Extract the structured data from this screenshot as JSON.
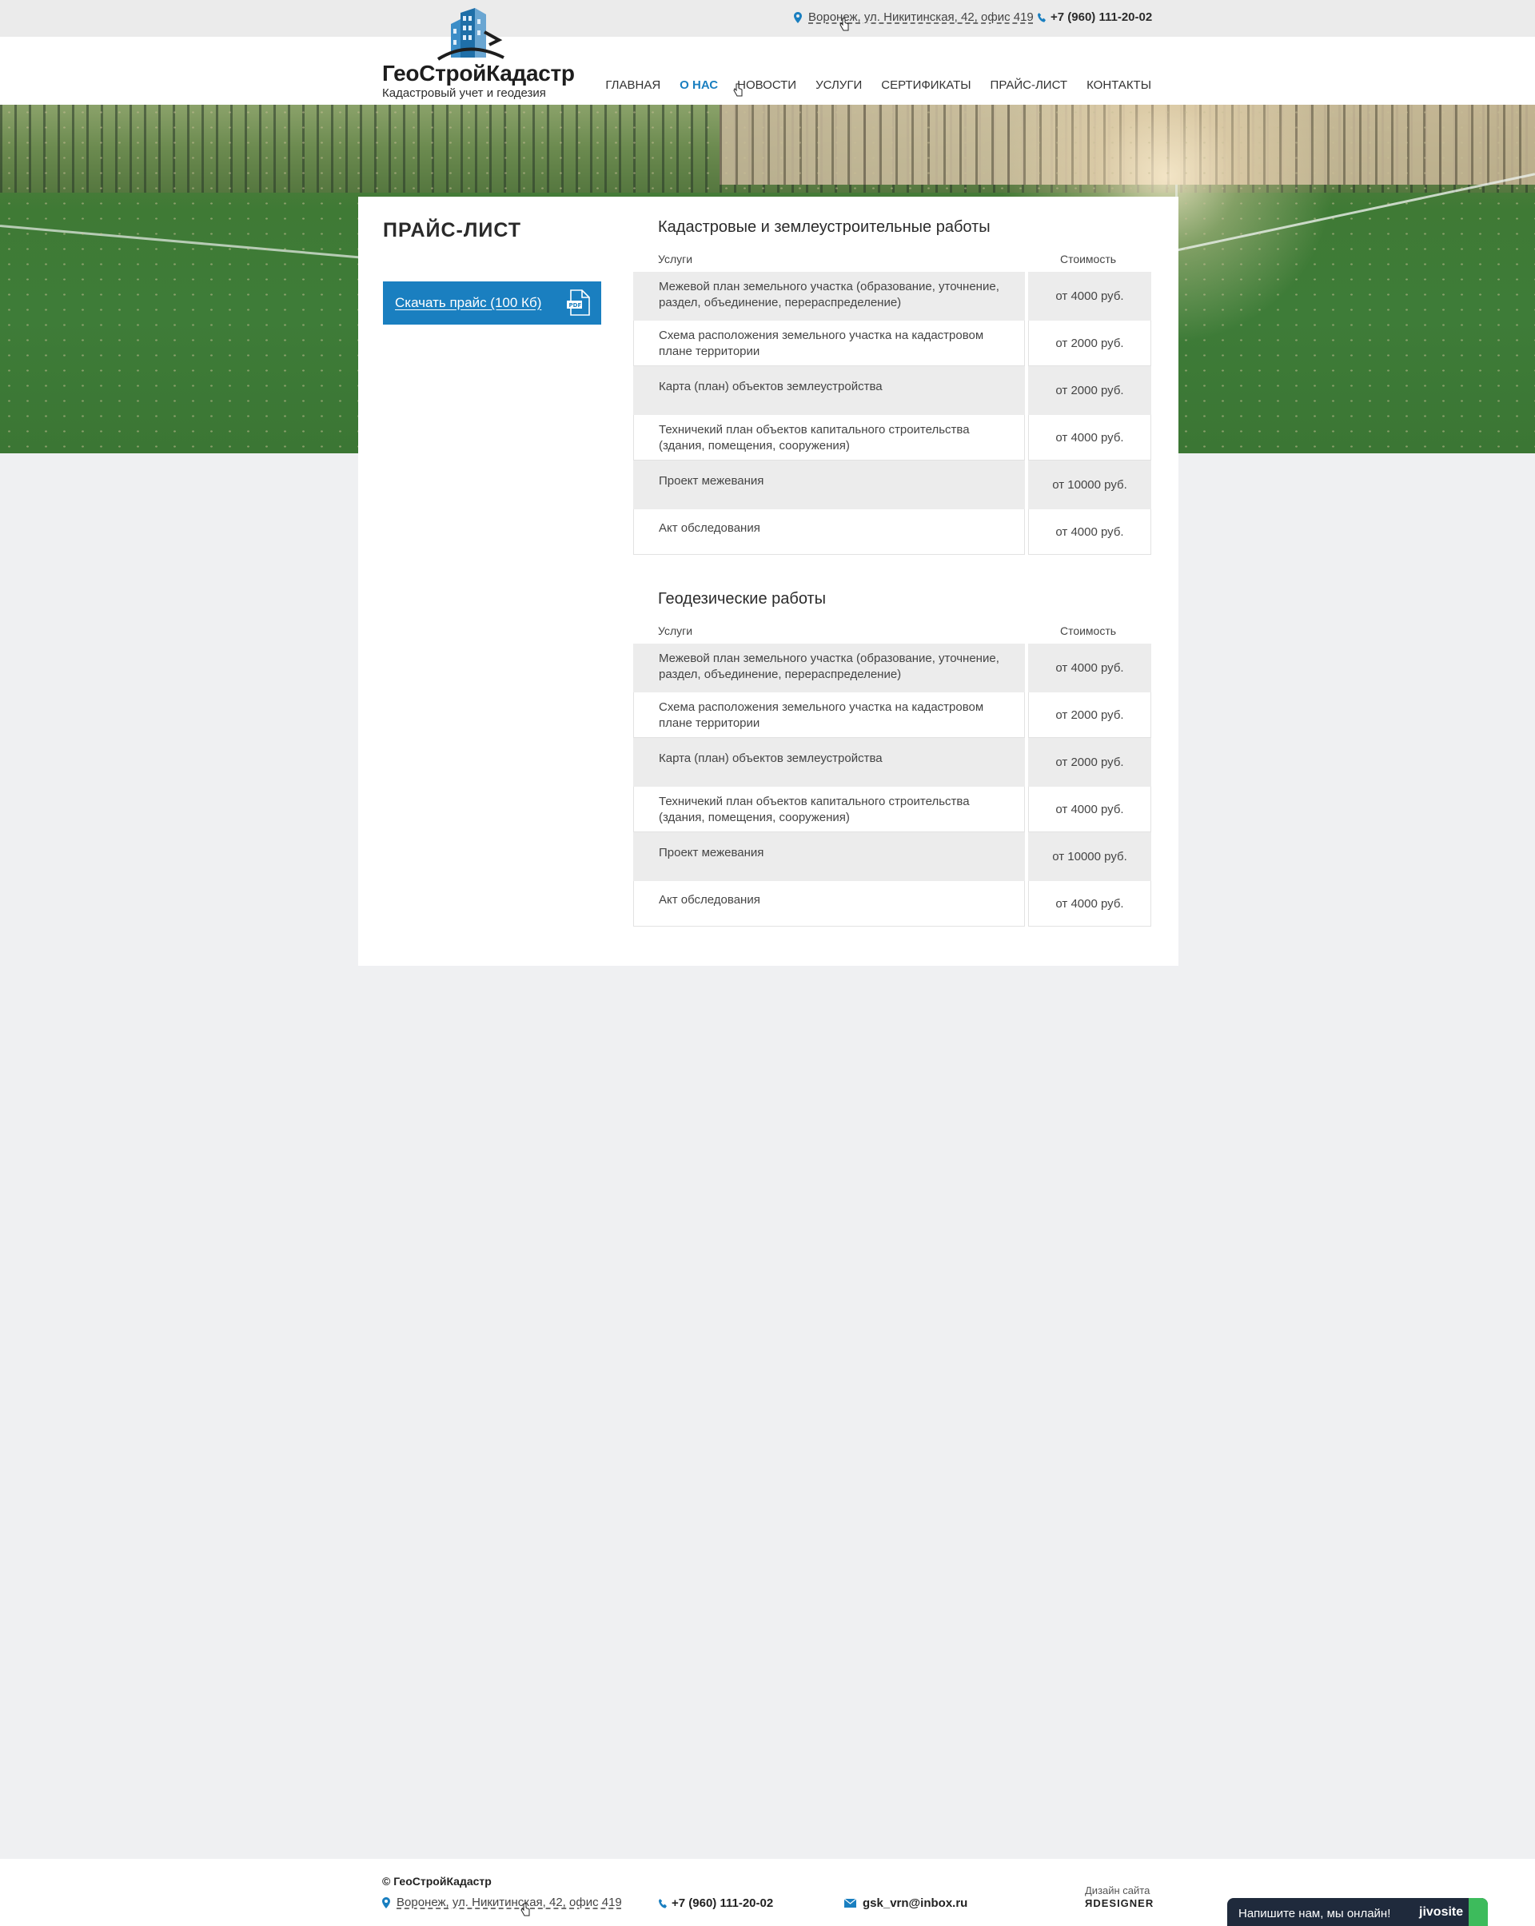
{
  "topbar": {
    "address": "Воронеж, ул. Никитинская, 42, офис 419",
    "phone": "+7 (960) 111-20-02"
  },
  "logo": {
    "title": "ГеоСтройКадастр",
    "subtitle": "Кадастровый учет и геодезия"
  },
  "nav": [
    {
      "label": "Главная",
      "active": false
    },
    {
      "label": "О нас",
      "active": true
    },
    {
      "label": "Новости",
      "active": false
    },
    {
      "label": "Услуги",
      "active": false
    },
    {
      "label": "Сертификаты",
      "active": false
    },
    {
      "label": "Прайс-лист",
      "active": false
    },
    {
      "label": "Контакты",
      "active": false
    }
  ],
  "page": {
    "title": "Прайс-лист",
    "download_label": "Скачать прайс (100 Кб)",
    "pdf_icon_text": "PDF"
  },
  "sections": [
    {
      "title": "Кадастровые и землеустроительные работы",
      "col_service": "Услуги",
      "col_price": "Стоимость",
      "rows": [
        {
          "service": "Межевой план земельного участка (образование, уточнение, раздел, объединение, перераспределение)",
          "price": "от 4000 руб."
        },
        {
          "service": "Схема расположения земельного участка на кадастровом плане территории",
          "price": "от 2000 руб."
        },
        {
          "service": "Карта (план) объектов землеустройства",
          "price": "от 2000 руб."
        },
        {
          "service": "Техничекий план объектов капитального строительства (здания, помещения, сооружения)",
          "price": "от 4000 руб."
        },
        {
          "service": "Проект межевания",
          "price": "от 10000 руб."
        },
        {
          "service": "Акт обследования",
          "price": "от 4000 руб."
        }
      ]
    },
    {
      "title": "Геодезические работы",
      "col_service": "Услуги",
      "col_price": "Стоимость",
      "rows": [
        {
          "service": "Межевой план земельного участка (образование, уточнение, раздел, объединение, перераспределение)",
          "price": "от 4000 руб."
        },
        {
          "service": "Схема расположения земельного участка на кадастровом плане территории",
          "price": "от 2000 руб."
        },
        {
          "service": "Карта (план) объектов землеустройства",
          "price": "от 2000 руб."
        },
        {
          "service": "Техничекий план объектов капитального строительства (здания, помещения, сооружения)",
          "price": "от 4000 руб."
        },
        {
          "service": "Проект межевания",
          "price": "от 10000 руб."
        },
        {
          "service": "Акт обследования",
          "price": "от 4000 руб."
        }
      ]
    }
  ],
  "footer": {
    "copyright": "© ГеоСтройКадастр",
    "address": "Воронеж, ул. Никитинская, 42, офис 419",
    "phone": "+7 (960) 111-20-02",
    "email": "gsk_vrn@inbox.ru",
    "design_label": "Дизайн сайта",
    "design_brand": "ЯDESIGNER"
  },
  "chat": {
    "message": "Напишите нам, мы онлайн!",
    "brand": "jivosite"
  },
  "colors": {
    "accent": "#1a7fc0",
    "row_shade": "#ececec",
    "page_bg": "#eff0f2",
    "chat_bg": "#1f2a3c"
  }
}
